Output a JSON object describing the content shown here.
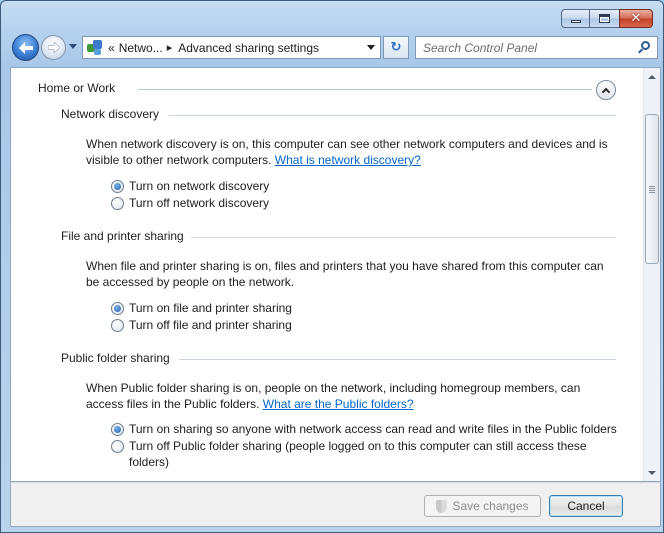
{
  "address_bar": {
    "breadcrumbs": [
      "Netwo...",
      "Advanced sharing settings"
    ],
    "overflow_glyph": "«",
    "separator_glyph": "▸"
  },
  "search": {
    "placeholder": "Search Control Panel"
  },
  "profile": {
    "title": "Home or Work"
  },
  "sections": {
    "network_discovery": {
      "title": "Network discovery",
      "desc_line1": "When network discovery is on, this computer can see other network computers and devices and is",
      "desc_line2": "visible to other network computers.",
      "link": "What is network discovery?",
      "options": [
        "Turn on network discovery",
        "Turn off network discovery"
      ],
      "selected": 0
    },
    "file_printer": {
      "title": "File and printer sharing",
      "desc_line1": "When file and printer sharing is on, files and printers that you have shared from this computer can",
      "desc_line2": "be accessed by people on the network.",
      "options": [
        "Turn on file and printer sharing",
        "Turn off file and printer sharing"
      ],
      "selected": 0
    },
    "public_folder": {
      "title": "Public folder sharing",
      "desc_line1": "When Public folder sharing is on, people on the network, including homegroup members, can",
      "desc_line2": "access files in the Public folders.",
      "link": "What are the Public folders?",
      "option1": "Turn on sharing so anyone with network access can read and write files in the Public folders",
      "option2_line1": "Turn off Public folder sharing (people logged on to this computer can still access these",
      "option2_line2": "folders)",
      "selected": 0
    }
  },
  "buttons": {
    "save": "Save changes",
    "cancel": "Cancel"
  },
  "icons": [
    "minimize-icon",
    "maximize-icon",
    "close-icon",
    "back-arrow-icon",
    "forward-arrow-icon",
    "network-icon",
    "refresh-icon",
    "search-icon",
    "chevron-up-icon",
    "uac-shield-icon"
  ],
  "colors": {
    "link": "#0066cc",
    "accent": "#3a7fd5"
  }
}
